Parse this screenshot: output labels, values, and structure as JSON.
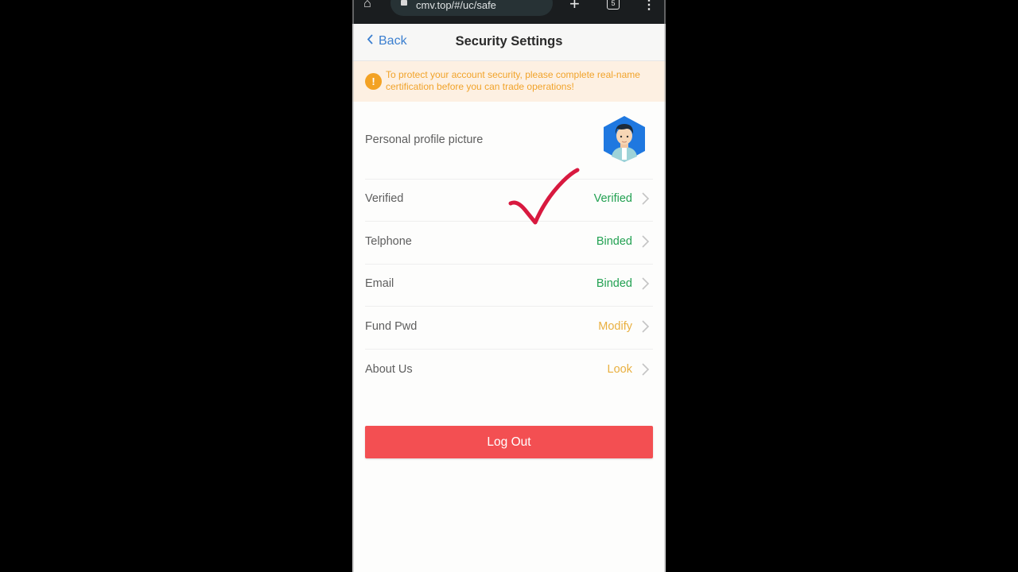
{
  "browser": {
    "url": "cmv.top/#/uc/safe",
    "tab_count": "5",
    "icons": {
      "home": "home-icon",
      "lock": "lock-icon",
      "new_tab": "plus-icon",
      "tabs": "tabs-icon",
      "menu": "more-vert-icon"
    }
  },
  "header": {
    "back_label": "Back",
    "title": "Security Settings"
  },
  "notice": {
    "icon": "warning-icon",
    "text": "To protect your account security, please complete real-name certification before you can trade operations!"
  },
  "profile": {
    "label": "Personal profile picture"
  },
  "settings": [
    {
      "label": "Verified",
      "value": "Verified",
      "status_color": "#23a152"
    },
    {
      "label": "Telphone",
      "value": "Binded",
      "status_color": "#23a152"
    },
    {
      "label": "Email",
      "value": "Binded",
      "status_color": "#23a152"
    },
    {
      "label": "Fund Pwd",
      "value": "Modify",
      "status_color": "#e9b040"
    },
    {
      "label": "About Us",
      "value": "Look",
      "status_color": "#e9b040"
    }
  ],
  "logout_label": "Log Out",
  "colors": {
    "accent_blue": "#3b7fd0",
    "logout_red": "#f34f52",
    "annotation_check": "#d8193f"
  }
}
